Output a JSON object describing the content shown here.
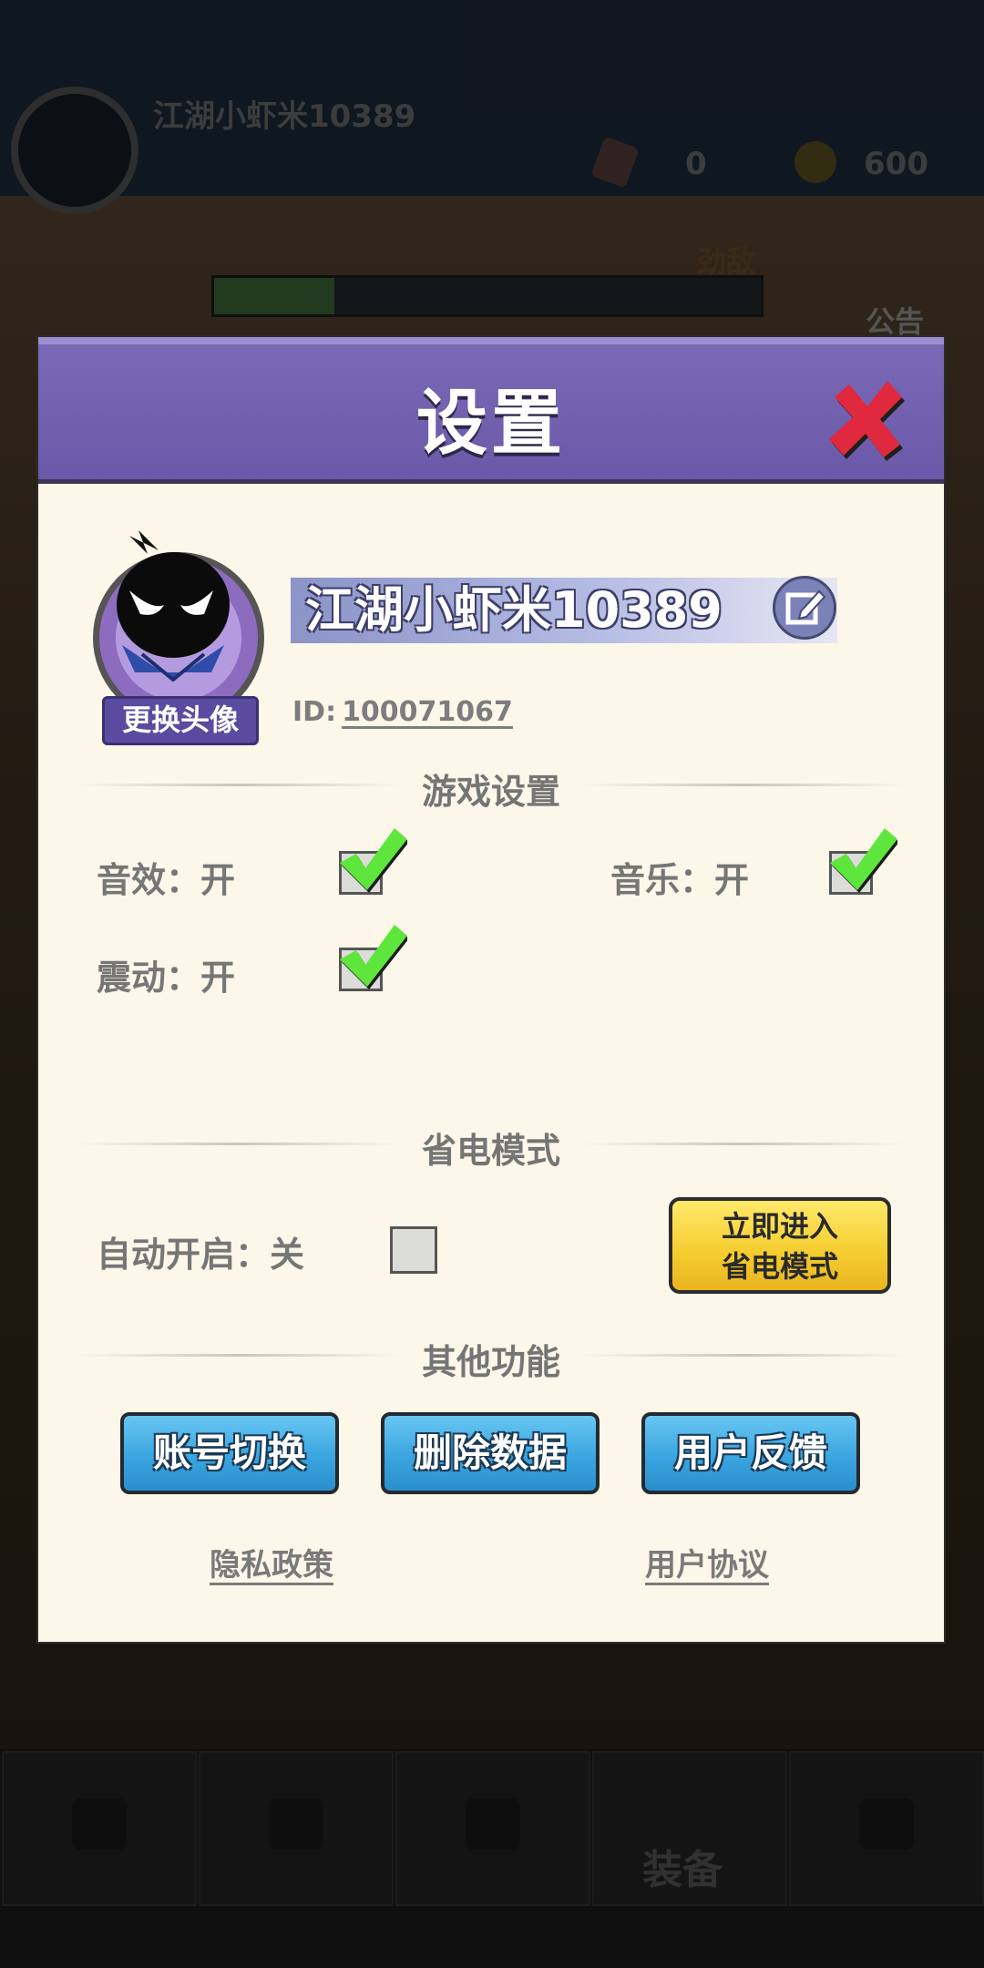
{
  "background": {
    "player_name": "江湖小虾米10389",
    "gem_count": "0",
    "coin_count": "600",
    "enemy_label": "劲敌",
    "notice_label": "公告",
    "equip_label": "装备"
  },
  "dialog": {
    "title": "设置",
    "close_icon": "close-x-icon",
    "profile": {
      "name": "江湖小虾米10389",
      "change_avatar_label": "更换头像",
      "id_label": "ID:",
      "id_value": "100071067"
    },
    "game_settings": {
      "title": "游戏设置",
      "sound": {
        "label": "音效：开",
        "checked": true
      },
      "music": {
        "label": "音乐：开",
        "checked": true
      },
      "vibration": {
        "label": "震动：开",
        "checked": true
      }
    },
    "power_saving": {
      "title": "省电模式",
      "auto_label": "自动开启：关",
      "auto_checked": false,
      "enter_line1": "立即进入",
      "enter_line2": "省电模式"
    },
    "other": {
      "title": "其他功能",
      "buttons": [
        "账号切换",
        "删除数据",
        "用户反馈"
      ],
      "privacy": "隐私政策",
      "agreement": "用户协议"
    },
    "colors": {
      "header": "#6a59a8",
      "panel": "#fdf7ea",
      "check_green": "#5ee63c",
      "button_blue": "#3aa5e0",
      "button_yellow": "#f5cc2e",
      "close_red": "#e0283e"
    }
  }
}
